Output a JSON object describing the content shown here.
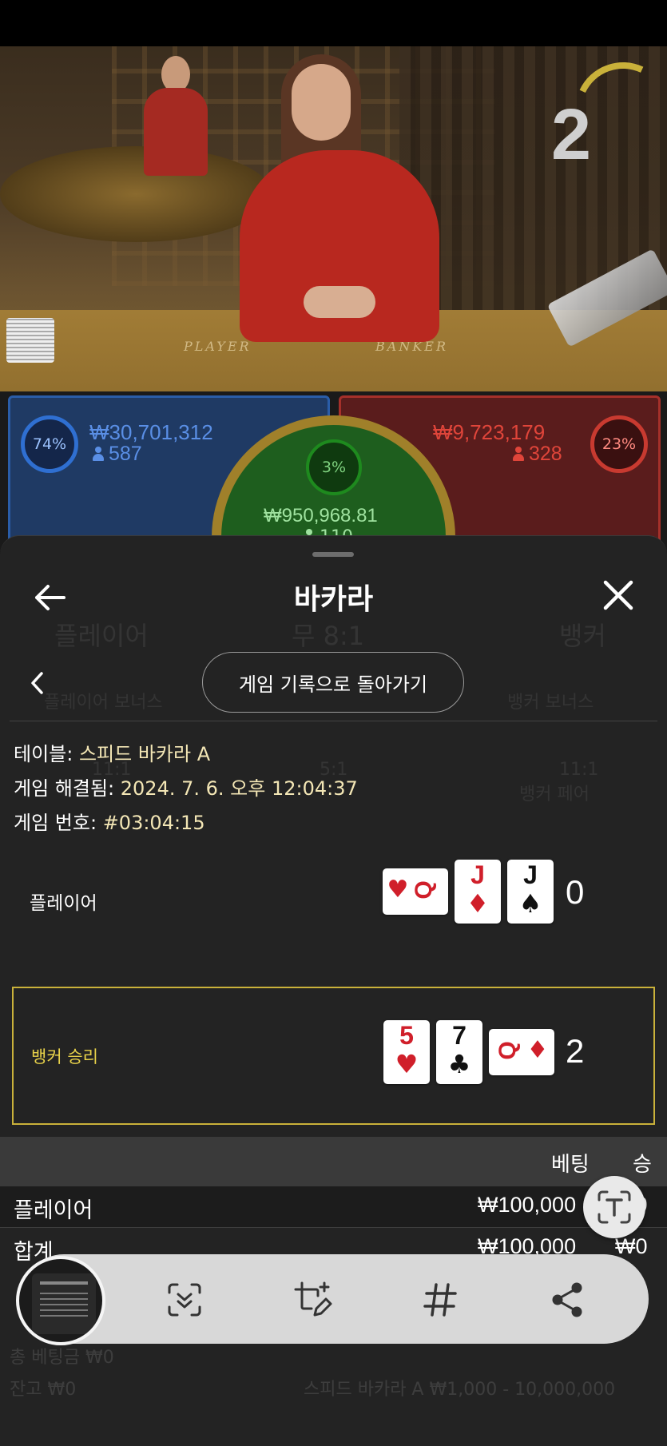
{
  "video": {
    "countdown": "2",
    "table_left_label": "PLAYER",
    "table_right_label": "BANKER"
  },
  "stats": {
    "player": {
      "percent": "74%",
      "amount": "₩30,701,312",
      "count": "587",
      "color": "#2f6fd1"
    },
    "tie": {
      "percent": "3%",
      "amount": "₩950,968.81",
      "count": "110",
      "color": "#1e8a1e"
    },
    "banker": {
      "percent": "23%",
      "amount": "₩9,723,179",
      "count": "328",
      "color": "#c83a30"
    }
  },
  "sheet": {
    "title": "바카라",
    "history_button": "게임 기록으로 돌아가기",
    "info": {
      "table_label": "테이블:",
      "table_value": "스피드 바카라 A",
      "resolved_label": "게임 해결됨:",
      "resolved_value": "2024. 7. 6. 오후 12:04:37",
      "number_label": "게임 번호:",
      "number_value": "#03:04:15"
    },
    "player_hand": {
      "label": "플레이어",
      "score": "0",
      "cards": [
        {
          "rank": "Q",
          "suit": "♥",
          "orientation": "horizontal"
        },
        {
          "rank": "J",
          "suit": "♦",
          "orientation": "vertical"
        },
        {
          "rank": "J",
          "suit": "♠",
          "orientation": "vertical"
        }
      ]
    },
    "banker_hand": {
      "label": "뱅커 승리",
      "score": "2",
      "cards": [
        {
          "rank": "5",
          "suit": "♥",
          "orientation": "vertical"
        },
        {
          "rank": "7",
          "suit": "♣",
          "orientation": "vertical"
        },
        {
          "rank": "Q",
          "suit": "♦",
          "orientation": "horizontal"
        }
      ],
      "highlight_color": "#c9b13a"
    },
    "bets": {
      "col_bet": "베팅",
      "col_win": "승",
      "rows": [
        {
          "name": "플레이어",
          "bet": "₩100,000",
          "win": "₩0"
        },
        {
          "name": "합계",
          "bet": "₩100,000",
          "win": "₩0"
        }
      ]
    },
    "background_ghost": {
      "player": "플레이어",
      "tie": "무 8:1",
      "banker": "뱅커",
      "player_bonus": "플레이어 보너스",
      "banker_bonus": "뱅커 보너스",
      "odds1": "11:1",
      "odds2": "5:1",
      "odds3": "11:1",
      "banker_pair": "뱅커 페어",
      "total_bet": "총 베팅금 ₩0",
      "balance": "잔고 ₩0",
      "table_limits": "스피드 바카라 A  ₩1,000 - 10,000,000"
    }
  },
  "toolbar": {
    "icons": [
      "capture-scroll-icon",
      "crop-edit-icon",
      "hashtag-icon",
      "share-icon"
    ]
  }
}
